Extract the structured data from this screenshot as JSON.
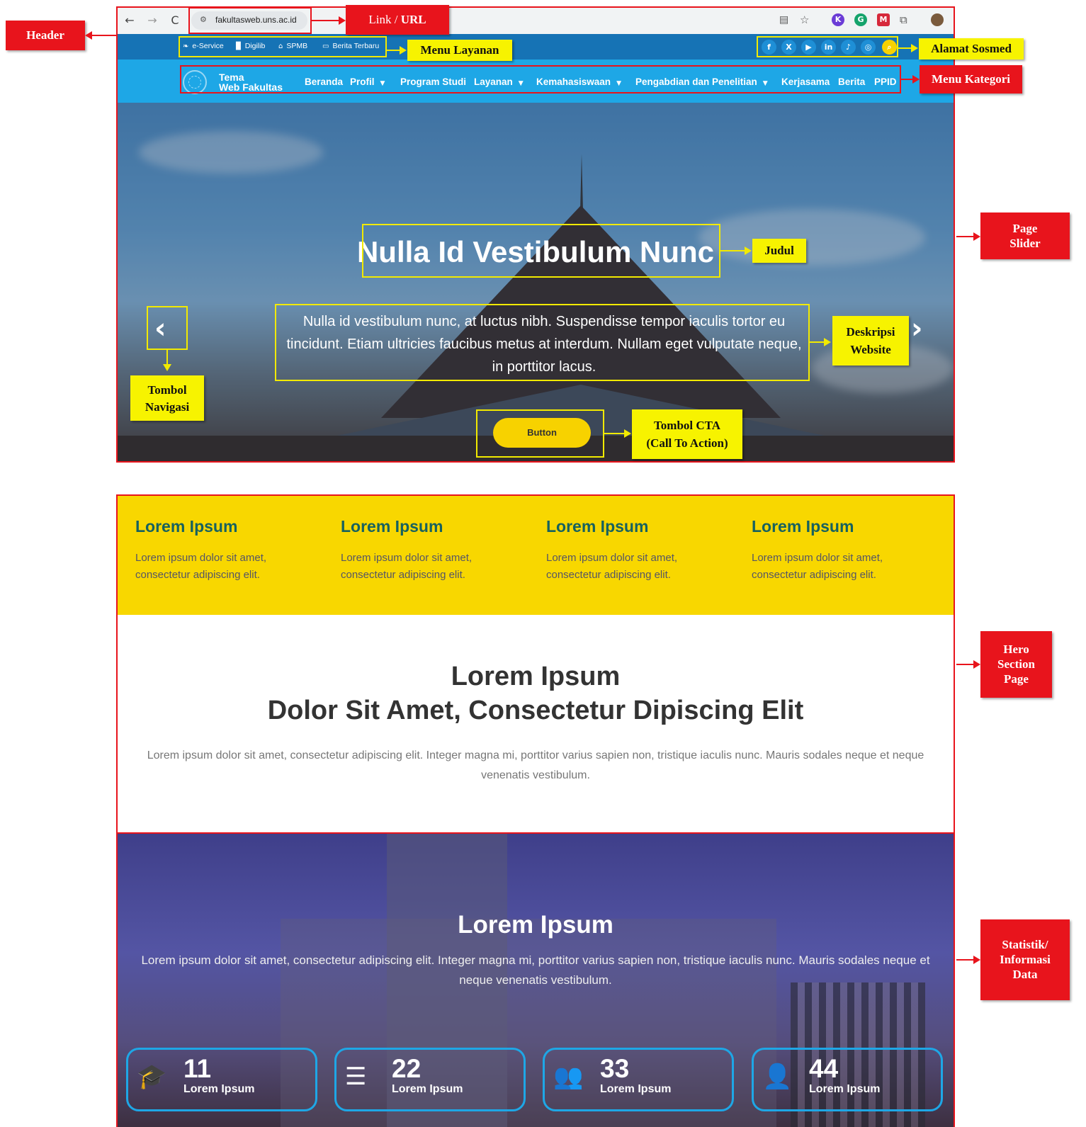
{
  "browser": {
    "url": "fakultasweb.uns.ac.id",
    "nav_back": "←",
    "nav_forward": "→",
    "nav_reload": "C"
  },
  "service_menu": [
    {
      "label": "e-Service",
      "icon": "leaf-icon"
    },
    {
      "label": "Digilib",
      "icon": "book-icon"
    },
    {
      "label": "SPMB",
      "icon": "building-icon"
    },
    {
      "label": "Berita Terbaru",
      "icon": "news-icon"
    }
  ],
  "social_icons": [
    "facebook-icon",
    "x-icon",
    "youtube-icon",
    "linkedin-icon",
    "tiktok-icon",
    "instagram-icon",
    "search-icon"
  ],
  "brand": {
    "line1": "Tema",
    "line2": "Web Fakultas"
  },
  "nav_menu": [
    {
      "label": "Beranda",
      "dropdown": false
    },
    {
      "label": "Profil",
      "dropdown": true
    },
    {
      "label": "Program Studi",
      "dropdown": false
    },
    {
      "label": "Layanan",
      "dropdown": true
    },
    {
      "label": "Kemahasiswaan",
      "dropdown": true
    },
    {
      "label": "Pengabdian dan Penelitian",
      "dropdown": true
    },
    {
      "label": "Kerjasama",
      "dropdown": false
    },
    {
      "label": "Berita",
      "dropdown": false
    },
    {
      "label": "PPID",
      "dropdown": false
    }
  ],
  "slider": {
    "title": "Nulla Id Vestibulum Nunc",
    "description": "Nulla id vestibulum nunc, at luctus nibh. Suspendisse tempor iaculis tortor eu tincidunt. Etiam ultricies faucibus metus at interdum. Nullam eget vulputate neque, in porttitor lacus.",
    "button": "Button",
    "prev": "‹",
    "next": "›"
  },
  "features": [
    {
      "title": "Lorem Ipsum",
      "text": "Lorem ipsum dolor sit amet, consectetur adipiscing elit."
    },
    {
      "title": "Lorem Ipsum",
      "text": "Lorem ipsum dolor sit amet, consectetur adipiscing elit."
    },
    {
      "title": "Lorem Ipsum",
      "text": "Lorem ipsum dolor sit amet, consectetur adipiscing elit."
    },
    {
      "title": "Lorem Ipsum",
      "text": "Lorem ipsum dolor sit amet, consectetur adipiscing elit."
    }
  ],
  "hero": {
    "title_line1": "Lorem Ipsum",
    "title_line2": "Dolor Sit Amet, Consectetur Dipiscing Elit",
    "text": "Lorem ipsum dolor sit amet, consectetur adipiscing elit. Integer magna mi, porttitor varius sapien non, tristique iaculis nunc. Mauris sodales neque et neque venenatis vestibulum."
  },
  "stats": {
    "title": "Lorem Ipsum",
    "text": "Lorem ipsum dolor sit amet, consectetur adipiscing elit. Integer magna mi, porttitor varius sapien non, tristique iaculis nunc. Mauris sodales neque et neque venenatis vestibulum.",
    "items": [
      {
        "number": "11",
        "label": "Lorem Ipsum",
        "icon": "graduation-cap-icon"
      },
      {
        "number": "22",
        "label": "Lorem Ipsum",
        "icon": "list-icon"
      },
      {
        "number": "33",
        "label": "Lorem Ipsum",
        "icon": "users-icon"
      },
      {
        "number": "44",
        "label": "Lorem Ipsum",
        "icon": "user-icon"
      }
    ]
  },
  "annotations": {
    "header": "Header",
    "link_url_prefix": "Link / ",
    "link_url_bold": "URL",
    "menu_layanan": "Menu Layanan",
    "alamat_sosmed": "Alamat Sosmed",
    "menu_kategori": "Menu Kategori",
    "page_slider_1": "Page",
    "page_slider_2": "Slider",
    "judul": "Judul",
    "deskripsi_1": "Deskripsi",
    "deskripsi_2": "Website",
    "tombol_nav_1": "Tombol",
    "tombol_nav_2": "Navigasi",
    "cta_1": "Tombol CTA",
    "cta_2": "(Call To Action)",
    "hero_1": "Hero",
    "hero_2": "Section",
    "hero_3": "Page",
    "stat_1": "Statistik/",
    "stat_2": "Informasi",
    "stat_3": "Data"
  },
  "colors": {
    "top_strip": "#1673b5",
    "menu_strip": "#1ea7e6",
    "accent_yellow": "#f8d700",
    "annotation_red": "#e8141c",
    "annotation_yellow": "#f7f300"
  }
}
